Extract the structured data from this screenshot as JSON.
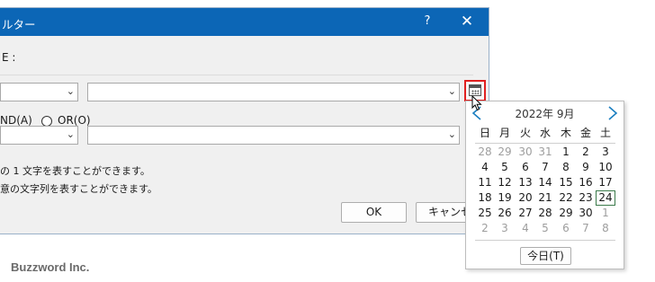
{
  "dialog": {
    "title": "ルター",
    "help_label": "?",
    "close_label": "✕",
    "section_label": "E :",
    "radio_and_label": "ND(A)",
    "radio_or_label": "OR(O)",
    "hint1": "の 1 文字を表すことができます。",
    "hint2": "意の文字列を表すことができます。",
    "ok_label": "OK",
    "cancel_label": "キャンセル"
  },
  "calendar": {
    "month_label": "2022年 9月",
    "weekdays": [
      "日",
      "月",
      "火",
      "水",
      "木",
      "金",
      "土"
    ],
    "weeks": [
      [
        {
          "d": "28",
          "o": true
        },
        {
          "d": "29",
          "o": true
        },
        {
          "d": "30",
          "o": true
        },
        {
          "d": "31",
          "o": true
        },
        {
          "d": "1"
        },
        {
          "d": "2"
        },
        {
          "d": "3"
        }
      ],
      [
        {
          "d": "4"
        },
        {
          "d": "5"
        },
        {
          "d": "6"
        },
        {
          "d": "7"
        },
        {
          "d": "8"
        },
        {
          "d": "9"
        },
        {
          "d": "10"
        }
      ],
      [
        {
          "d": "11"
        },
        {
          "d": "12"
        },
        {
          "d": "13"
        },
        {
          "d": "14"
        },
        {
          "d": "15"
        },
        {
          "d": "16"
        },
        {
          "d": "17"
        }
      ],
      [
        {
          "d": "18"
        },
        {
          "d": "19"
        },
        {
          "d": "20"
        },
        {
          "d": "21"
        },
        {
          "d": "22"
        },
        {
          "d": "23"
        },
        {
          "d": "24",
          "today": true
        }
      ],
      [
        {
          "d": "25"
        },
        {
          "d": "26"
        },
        {
          "d": "27"
        },
        {
          "d": "28"
        },
        {
          "d": "29"
        },
        {
          "d": "30"
        },
        {
          "d": "1",
          "o": true
        }
      ],
      [
        {
          "d": "2",
          "o": true
        },
        {
          "d": "3",
          "o": true
        },
        {
          "d": "4",
          "o": true
        },
        {
          "d": "5",
          "o": true
        },
        {
          "d": "6",
          "o": true
        },
        {
          "d": "7",
          "o": true
        },
        {
          "d": "8",
          "o": true
        }
      ]
    ],
    "today_label": "今日(T)"
  },
  "footer": {
    "brand": "Buzzword Inc."
  },
  "colors": {
    "titlebar": "#0c66b6",
    "highlight": "#e02020",
    "nav_arrow": "#1a7ec0"
  }
}
